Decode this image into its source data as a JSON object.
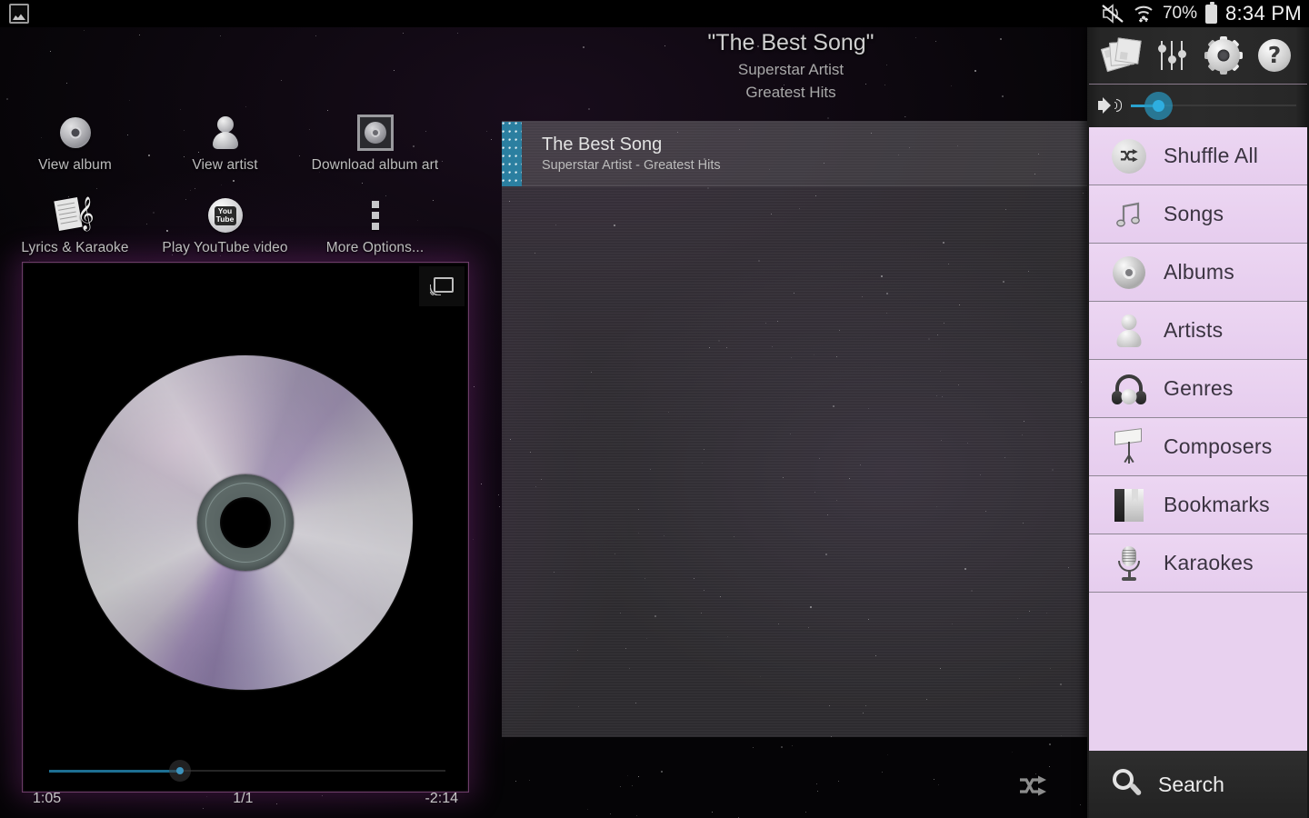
{
  "status_bar": {
    "mute_icon": "mute-icon",
    "wifi_icon": "wifi-icon",
    "battery_percent": "70%",
    "battery_icon": "battery-icon",
    "clock": "8:34 PM",
    "notification_icon": "gallery-image-icon"
  },
  "now_playing": {
    "title": "\"The Best Song\"",
    "artist": "Superstar Artist",
    "album": "Greatest Hits"
  },
  "quick_actions": [
    {
      "label": "View album",
      "icon": "cd-disc-icon"
    },
    {
      "label": "View artist",
      "icon": "person-icon"
    },
    {
      "label": "Download album art",
      "icon": "framed-album-art-icon"
    },
    {
      "label": "Lyrics & Karaoke",
      "icon": "lyrics-sheet-icon"
    },
    {
      "label": "Play YouTube video",
      "icon": "youtube-icon"
    },
    {
      "label": "More Options...",
      "icon": "overflow-dots-icon"
    }
  ],
  "album_art": {
    "cast_icon": "cast-icon",
    "disc_icon": "cd-disc-art"
  },
  "playlist": {
    "rows": [
      {
        "title": "The Best Song",
        "subtitle": "Superstar Artist - Greatest Hits",
        "grip_icon": "drag-handle-icon"
      }
    ],
    "shuffle_icon": "shuffle-icon"
  },
  "transport": {
    "elapsed": "1:05",
    "track_position": "1/1",
    "remaining": "-2:14",
    "progress_percent": 33
  },
  "drawer": {
    "top_icons": [
      {
        "name": "albums-grid-icon",
        "label": "Album grid"
      },
      {
        "name": "equalizer-icon",
        "label": "Equalizer"
      },
      {
        "name": "gear-icon",
        "label": "Settings"
      },
      {
        "name": "help-icon",
        "label": "Help"
      }
    ],
    "volume": {
      "speaker_icon": "speaker-icon",
      "level_percent": 8
    },
    "menu_items": [
      {
        "label": "Shuffle All",
        "icon": "shuffle-icon"
      },
      {
        "label": "Songs",
        "icon": "music-note-icon"
      },
      {
        "label": "Albums",
        "icon": "cd-disc-icon"
      },
      {
        "label": "Artists",
        "icon": "person-icon"
      },
      {
        "label": "Genres",
        "icon": "headphones-icon"
      },
      {
        "label": "Composers",
        "icon": "music-stand-icon"
      },
      {
        "label": "Bookmarks",
        "icon": "bookmark-book-icon"
      },
      {
        "label": "Karaokes",
        "icon": "microphone-icon"
      }
    ],
    "search": {
      "label": "Search",
      "icon": "search-icon"
    },
    "handle_icon": "drawer-arrow-icon"
  },
  "colors": {
    "accent_blue": "#2eaee0",
    "menu_lilac": "#e8d1ef",
    "grip_teal": "#2b7fa0",
    "glow_purple": "#c46ebe"
  }
}
